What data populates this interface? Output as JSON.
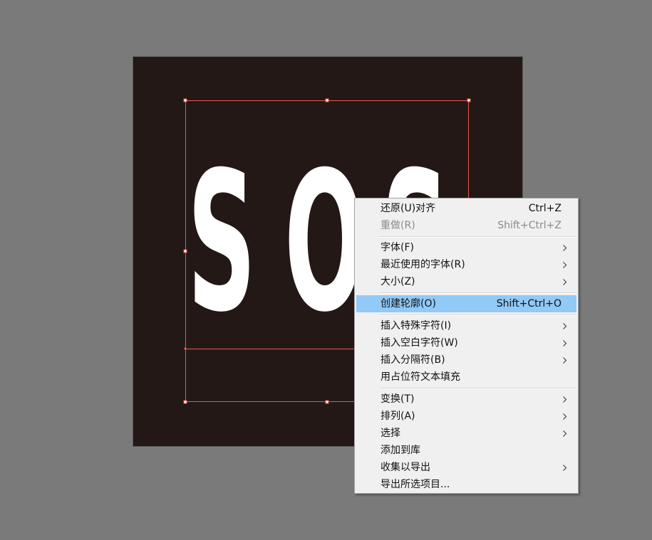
{
  "canvas": {
    "artwork_text": [
      "S",
      "O",
      "S"
    ],
    "colors": {
      "pasteboard": "#7a7a7a",
      "artboard": "#231816",
      "selection": "#e8584f",
      "menu_highlight": "#91c9f7"
    }
  },
  "context_menu": {
    "groups": [
      [
        {
          "label": "还原(U)对齐",
          "shortcut": "Ctrl+Z",
          "enabled": true,
          "submenu": false
        },
        {
          "label": "重做(R)",
          "shortcut": "Shift+Ctrl+Z",
          "enabled": false,
          "submenu": false
        }
      ],
      [
        {
          "label": "字体(F)",
          "shortcut": "",
          "enabled": true,
          "submenu": true,
          "icon": "chevron-right-icon"
        },
        {
          "label": "最近使用的字体(R)",
          "shortcut": "",
          "enabled": true,
          "submenu": true,
          "icon": "chevron-right-icon"
        },
        {
          "label": "大小(Z)",
          "shortcut": "",
          "enabled": true,
          "submenu": true,
          "icon": "chevron-right-icon"
        }
      ],
      [
        {
          "label": "创建轮廓(O)",
          "shortcut": "Shift+Ctrl+O",
          "enabled": true,
          "submenu": false,
          "highlighted": true
        }
      ],
      [
        {
          "label": "插入特殊字符(I)",
          "shortcut": "",
          "enabled": true,
          "submenu": true,
          "icon": "chevron-right-icon"
        },
        {
          "label": "插入空白字符(W)",
          "shortcut": "",
          "enabled": true,
          "submenu": true,
          "icon": "chevron-right-icon"
        },
        {
          "label": "插入分隔符(B)",
          "shortcut": "",
          "enabled": true,
          "submenu": true,
          "icon": "chevron-right-icon"
        },
        {
          "label": "用占位符文本填充",
          "shortcut": "",
          "enabled": true,
          "submenu": false
        }
      ],
      [
        {
          "label": "变换(T)",
          "shortcut": "",
          "enabled": true,
          "submenu": true,
          "icon": "chevron-right-icon"
        },
        {
          "label": "排列(A)",
          "shortcut": "",
          "enabled": true,
          "submenu": true,
          "icon": "chevron-right-icon"
        },
        {
          "label": "选择",
          "shortcut": "",
          "enabled": true,
          "submenu": true,
          "icon": "chevron-right-icon"
        },
        {
          "label": "添加到库",
          "shortcut": "",
          "enabled": true,
          "submenu": false
        },
        {
          "label": "收集以导出",
          "shortcut": "",
          "enabled": true,
          "submenu": true,
          "icon": "chevron-right-icon"
        },
        {
          "label": "导出所选项目...",
          "shortcut": "",
          "enabled": true,
          "submenu": false
        }
      ]
    ]
  }
}
